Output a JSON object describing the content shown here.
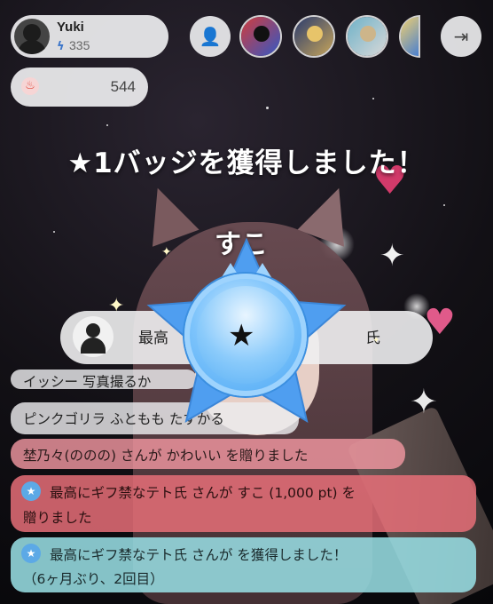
{
  "user": {
    "name": "Yuki",
    "points": "335"
  },
  "flame": {
    "value": "544"
  },
  "announcement": "★1バッジを獲得しました！",
  "pinned": {
    "text_left": "最高",
    "text_right": "氏"
  },
  "badge": {
    "mark": "★"
  },
  "comments": {
    "c1": "イッシー  写真撮るか",
    "c2": "ピンクゴリラ ふともも   たすかる",
    "c3": "埜乃々(ののの)  さんが かわいい を贈りました",
    "c4_line1": "最高にギフ禁なテト氏  さんが すこ (1,000 pt) を",
    "c4_line2": "贈りました",
    "c5_line1": "最高にギフ禁なテト氏  さんが   を獲得しました！",
    "c5_line2": "（6ヶ月ぶり、2回目）"
  },
  "overlay_text": "すこ",
  "colors": {
    "badge": "#5ab0f5",
    "accent_red": "#e0473a"
  }
}
